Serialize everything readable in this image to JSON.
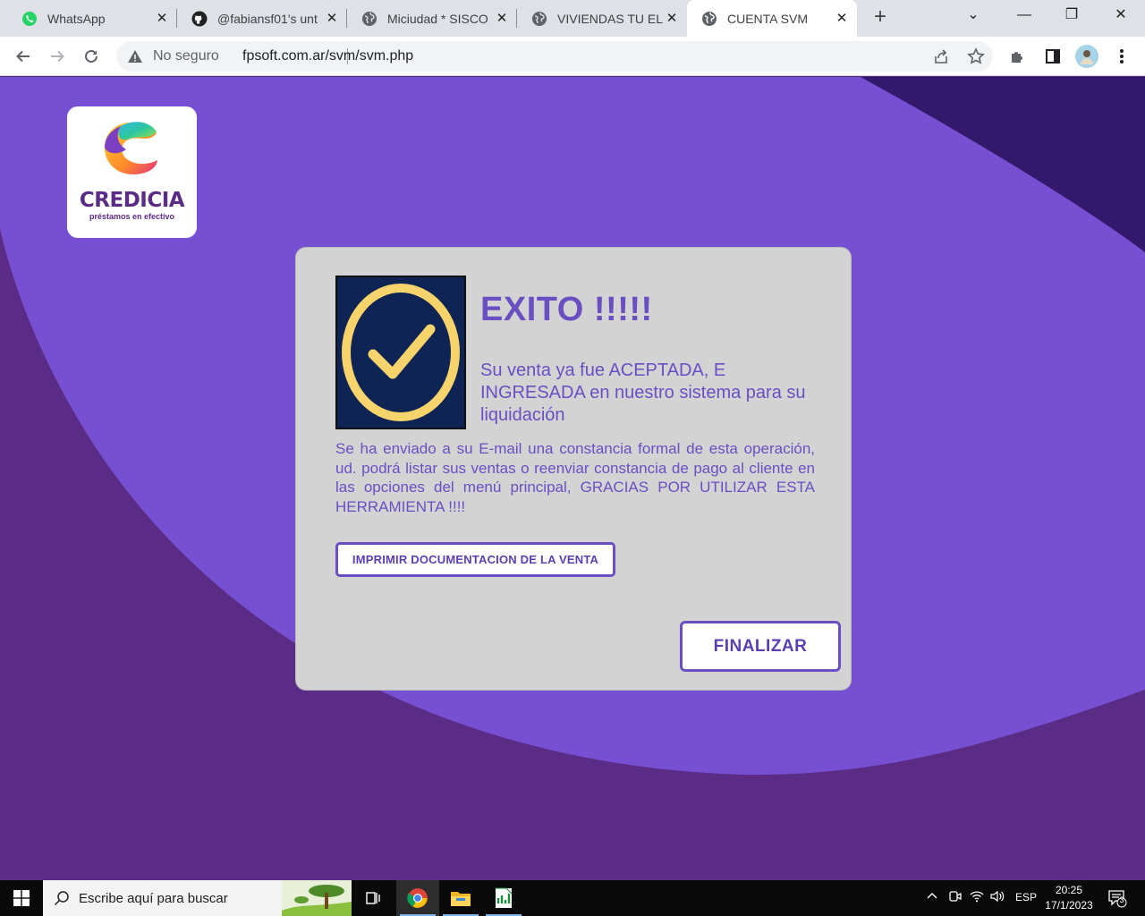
{
  "browser": {
    "tabs": [
      {
        "title": "WhatsApp",
        "icon": "whatsapp-icon"
      },
      {
        "title": "@fabiansf01's unt",
        "icon": "github-icon"
      },
      {
        "title": "Miciudad * SISCO",
        "icon": "globe-icon"
      },
      {
        "title": "VIVIENDAS TU EL",
        "icon": "globe-icon"
      },
      {
        "title": "CUENTA SVM",
        "icon": "globe-icon",
        "active": true
      }
    ],
    "security_label": "No seguro",
    "url": "fpsoft.com.ar/svm/svm.php"
  },
  "logo": {
    "name": "CREDICIA",
    "tagline": "préstamos en efectivo"
  },
  "result": {
    "title": "EXITO !!!!!",
    "subtitle": "Su venta ya fue ACEPTADA, E INGRESADA en nuestro sistema para su liquidación",
    "message": "Se ha enviado a su E-mail una constancia formal de esta operación, ud. podrá listar sus ventas o reenviar constancia de pago al cliente en las opciones del menú principal,  GRACIAS POR UTILIZAR ESTA HERRAMIENTA !!!!",
    "print_button": "IMPRIMIR DOCUMENTACION DE LA VENTA",
    "finish_button": "FINALIZAR"
  },
  "taskbar": {
    "search_placeholder": "Escribe aquí para buscar",
    "language": "ESP",
    "time": "20:25",
    "date": "17/1/2023",
    "notification_count": "3"
  },
  "colors": {
    "page_bg": "#5b2c86",
    "wave": "#764fd3",
    "accent_text": "#6a4fc3",
    "card_bg": "#d3d3d3",
    "check_bg": "#0e2454",
    "check_ring": "#f7d36b"
  }
}
